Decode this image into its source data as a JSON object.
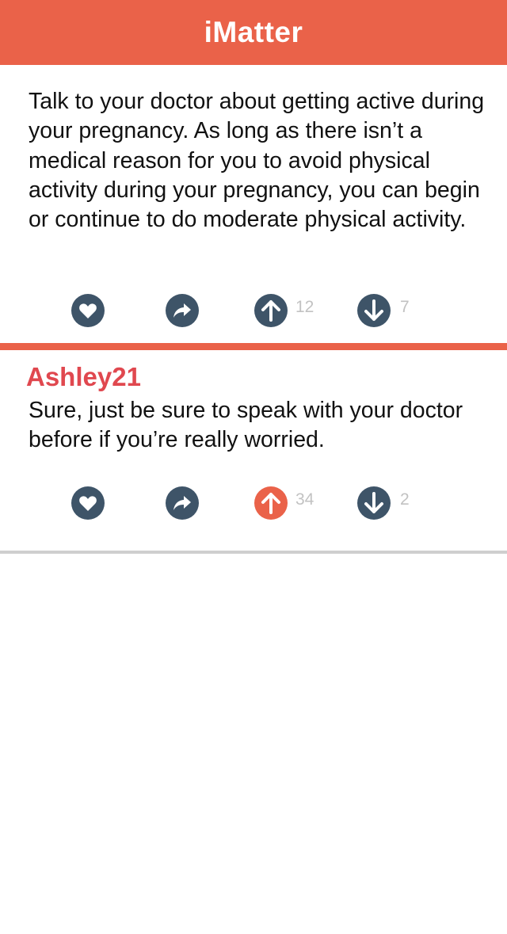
{
  "header": {
    "title": "iMatter"
  },
  "post": {
    "text": "Talk to your doctor about getting active during your pregnancy. As long as there isn’t a medical reason for you to avoid physical activity during your pregnancy, you can begin or continue to do moderate physical activity.",
    "upvotes": "12",
    "downvotes": "7"
  },
  "reply": {
    "author": "Ashley21",
    "text": "Sure, just be sure to speak with your doctor before if you’re really worried.",
    "upvotes": "34",
    "downvotes": "2",
    "upvoted": true
  },
  "colors": {
    "accent": "#EA6249",
    "author": "#E0484F",
    "icon": "#3E5468",
    "count": "#c2c2c2"
  },
  "icons": [
    "heart-icon",
    "share-icon",
    "arrow-up-icon",
    "arrow-down-icon"
  ]
}
